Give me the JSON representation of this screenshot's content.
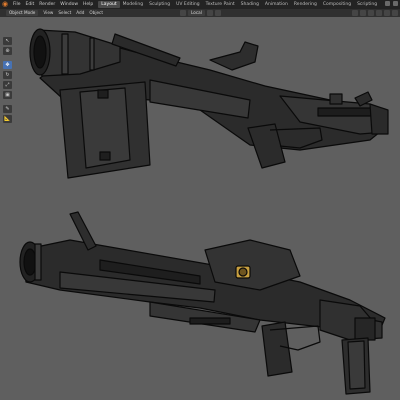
{
  "app": {
    "logo_glyph": "◉",
    "menus": [
      "File",
      "Edit",
      "Render",
      "Window",
      "Help"
    ],
    "workspaces": [
      "Layout",
      "Modeling",
      "Sculpting",
      "UV Editing",
      "Texture Paint",
      "Shading",
      "Animation",
      "Rendering",
      "Compositing",
      "Scripting"
    ],
    "active_workspace": "Layout"
  },
  "header": {
    "mode": "Object Mode",
    "menus": [
      "View",
      "Select",
      "Add",
      "Object"
    ],
    "orientation": "Local"
  },
  "toolbar": {
    "tools": [
      {
        "name": "cursor",
        "glyph": "↖"
      },
      {
        "name": "cursor-3d",
        "glyph": "⊕"
      },
      {
        "name": "move",
        "glyph": "✥"
      },
      {
        "name": "rotate",
        "glyph": "↻"
      },
      {
        "name": "scale",
        "glyph": "⤢"
      },
      {
        "name": "transform",
        "glyph": "▣"
      },
      {
        "name": "annotate",
        "glyph": "✎"
      },
      {
        "name": "measure",
        "glyph": "📐"
      }
    ],
    "active_tool": "move"
  },
  "viewport": {
    "background_color": "#5f5f5f",
    "model_dark": "#2b2b2b",
    "model_mid": "#3a3a3a",
    "outline": "#0a0a0a",
    "accent": "#c8a040"
  }
}
